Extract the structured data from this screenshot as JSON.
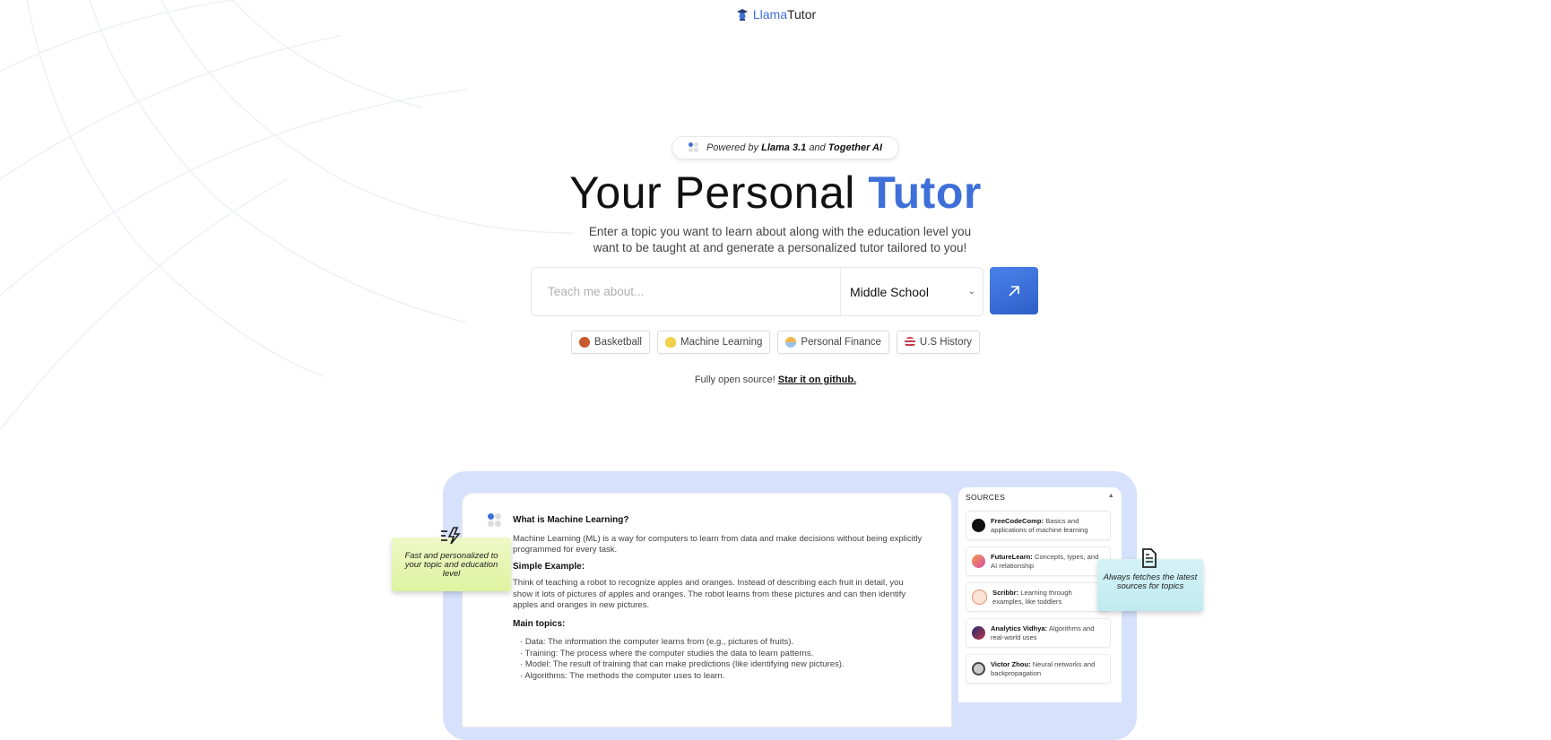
{
  "header": {
    "logo_part1": "Llama",
    "logo_part2": "Tutor",
    "logo_icon": "graduation-llama-icon"
  },
  "powered_by": {
    "prefix": "Powered by",
    "model": "Llama 3.1",
    "conjunction": "and",
    "provider": "Together AI",
    "icon": "dots-icon"
  },
  "hero": {
    "title_main": "Your Personal",
    "title_accent": "Tutor",
    "subtitle": "Enter a topic you want to learn about along with the education level you want to be taught at and generate a personalized tutor tailored to you!"
  },
  "search": {
    "value": "",
    "placeholder": "Teach me about...",
    "level_selected": "Middle School",
    "submit_icon": "arrow-up-right-icon"
  },
  "suggestions": [
    {
      "label": "Basketball",
      "icon": "basketball-icon"
    },
    {
      "label": "Machine Learning",
      "icon": "lightbulb-icon"
    },
    {
      "label": "Personal Finance",
      "icon": "money-hand-icon"
    },
    {
      "label": "U.S History",
      "icon": "us-flag-icon"
    }
  ],
  "open_source": {
    "text": "Fully open source!",
    "link": "Star it on github."
  },
  "preview": {
    "heading": "What is Machine Learning?",
    "intro": "Machine Learning (ML) is a way for computers to learn from data and make decisions without being explicitly programmed for every task.",
    "example_heading": "Simple Example:",
    "example_text": "Think of teaching a robot to recognize apples and oranges. Instead of describing each fruit in detail, you show it lots of pictures of apples and oranges. The robot learns from these pictures and can then identify apples and oranges in new pictures.",
    "topics_heading": "Main topics:",
    "topics": [
      "Data: The information the computer learns from (e.g., pictures of fruits).",
      "Training: The process where the computer studies the data to learn patterns.",
      "Model: The result of training that can make predictions (like identifying new pictures).",
      "Algorithms: The methods the computer uses to learn."
    ],
    "sources_title": "SOURCES",
    "sources": [
      {
        "name": "FreeCodeComp:",
        "desc": "Basics and applications of machine learning",
        "color": "#111111"
      },
      {
        "name": "FutureLearn:",
        "desc": "Concepts, types, and AI relationship",
        "color": "#e0559a"
      },
      {
        "name": "Scribbr:",
        "desc": "Learning through examples, like toddlers",
        "color": "#f4d3c4"
      },
      {
        "name": "Analytics Vidhya:",
        "desc": "Algorithms and real-world uses",
        "color": "#2a3a7a"
      },
      {
        "name": "Victor Zhou:",
        "desc": "Neural networks and backpropagation",
        "color": "#555555"
      }
    ]
  },
  "callouts": {
    "left": "Fast and personalized to your topic and education level",
    "right": "Always fetches the latest sources for topics"
  },
  "colors": {
    "accent": "#3f6fd8",
    "frame": "#d6e1fb",
    "callout_left": "#e6f5b3",
    "callout_right": "#c8eef3"
  }
}
